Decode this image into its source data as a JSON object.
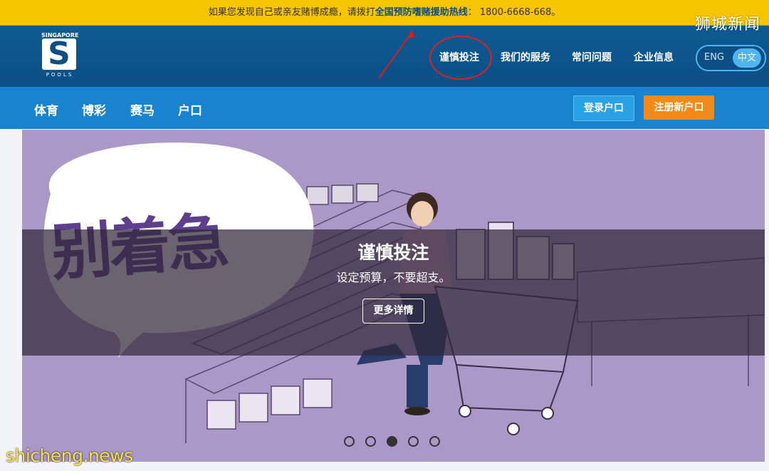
{
  "topbar": {
    "text_before": "如果您发现自己或亲友赌博成瘾，请拨打",
    "hotline_label": "全国预防嗜赌援助热线",
    "text_after": "： 1800-6668-668。"
  },
  "watermark_top": "狮城新闻",
  "logo": {
    "top": "SINGAPORE",
    "letter": "S",
    "bottom": "POOLS"
  },
  "header_nav": [
    {
      "label": "谨慎投注"
    },
    {
      "label": "我们的服务"
    },
    {
      "label": "常问问题"
    },
    {
      "label": "企业信息"
    }
  ],
  "lang": {
    "eng": "ENG",
    "zh": "中文",
    "selected": "中文"
  },
  "subnav": [
    {
      "label": "体育"
    },
    {
      "label": "博彩"
    },
    {
      "label": "赛马"
    },
    {
      "label": "户口"
    }
  ],
  "buttons": {
    "login": "登录户口",
    "register": "注册新户口"
  },
  "hero": {
    "bubble_text": "别着急",
    "title": "谨慎投注",
    "subtitle": "设定预算，不要超支。",
    "cta": "更多详情",
    "slide_count": 5,
    "active_slide": 3
  },
  "watermark_bottom": "shicheng.news",
  "colors": {
    "topbar": "#f6c400",
    "header": "#0b4f86",
    "subnav": "#1a83cf",
    "login": "#2aa0e6",
    "register": "#f28a1a",
    "hero_bg": "#ac97c9"
  }
}
